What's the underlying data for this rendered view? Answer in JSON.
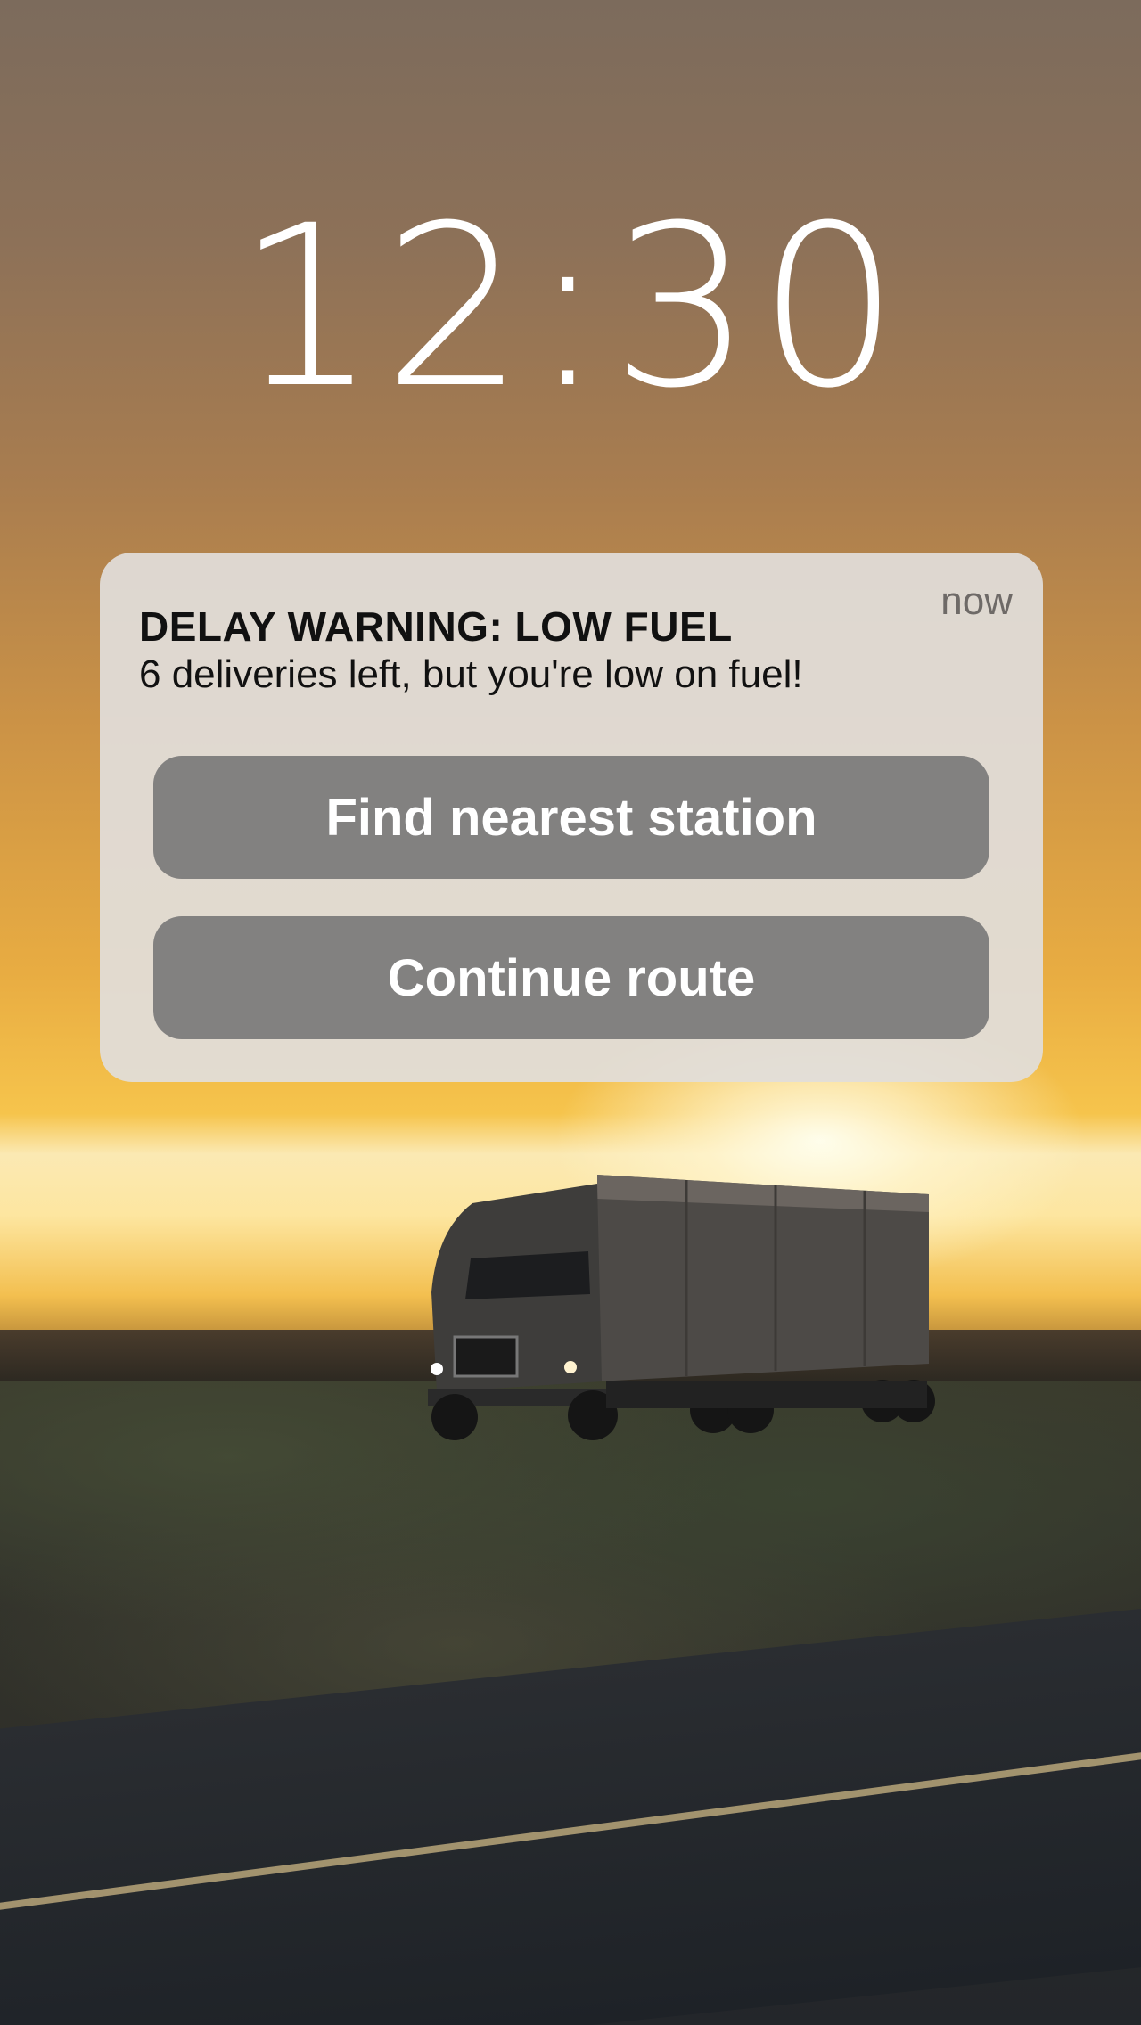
{
  "lock_screen": {
    "time": "12:30"
  },
  "notification": {
    "timestamp": "now",
    "title": "DELAY WARNING: LOW FUEL",
    "body": "6 deliveries left, but you're low on fuel!",
    "actions": [
      {
        "label": "Find nearest station"
      },
      {
        "label": "Continue route"
      }
    ]
  },
  "wallpaper": {
    "subject": "truck-at-sunset",
    "colors": {
      "sky_top": "#7c6b5c",
      "sky_horizon": "#f6c44c",
      "ground": "#2e2a23"
    }
  }
}
